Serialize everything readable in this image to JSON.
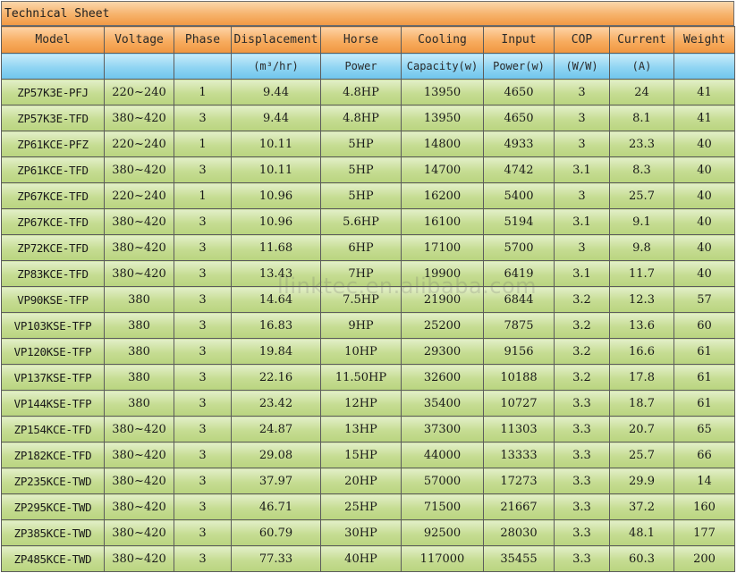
{
  "sheet_title": "Technical Sheet",
  "watermark": "llinktec.en.alibaba.com",
  "header_row1": [
    "Model",
    "Voltage",
    "Phase",
    "Displacement",
    "Horse",
    "Cooling",
    "Input",
    "COP",
    "Current",
    "Weight"
  ],
  "header_row2": [
    "",
    "",
    "",
    "(m³/hr)",
    "Power",
    "Capacity(w)",
    "Power(w)",
    "(W/W)",
    "(A)",
    ""
  ],
  "rows": [
    [
      "ZP57K3E-PFJ",
      "220~240",
      "1",
      "9.44",
      "4.8HP",
      "13950",
      "4650",
      "3",
      "24",
      "41"
    ],
    [
      "ZP57K3E-TFD",
      "380~420",
      "3",
      "9.44",
      "4.8HP",
      "13950",
      "4650",
      "3",
      "8.1",
      "41"
    ],
    [
      "ZP61KCE-PFZ",
      "220~240",
      "1",
      "10.11",
      "5HP",
      "14800",
      "4933",
      "3",
      "23.3",
      "40"
    ],
    [
      "ZP61KCE-TFD",
      "380~420",
      "3",
      "10.11",
      "5HP",
      "14700",
      "4742",
      "3.1",
      "8.3",
      "40"
    ],
    [
      "ZP67KCE-TFD",
      "220~240",
      "1",
      "10.96",
      "5HP",
      "16200",
      "5400",
      "3",
      "25.7",
      "40"
    ],
    [
      "ZP67KCE-TFD",
      "380~420",
      "3",
      "10.96",
      "5.6HP",
      "16100",
      "5194",
      "3.1",
      "9.1",
      "40"
    ],
    [
      "ZP72KCE-TFD",
      "380~420",
      "3",
      "11.68",
      "6HP",
      "17100",
      "5700",
      "3",
      "9.8",
      "40"
    ],
    [
      "ZP83KCE-TFD",
      "380~420",
      "3",
      "13.43",
      "7HP",
      "19900",
      "6419",
      "3.1",
      "11.7",
      "40"
    ],
    [
      "VP90KSE-TFP",
      "380",
      "3",
      "14.64",
      "7.5HP",
      "21900",
      "6844",
      "3.2",
      "12.3",
      "57"
    ],
    [
      "VP103KSE-TFP",
      "380",
      "3",
      "16.83",
      "9HP",
      "25200",
      "7875",
      "3.2",
      "13.6",
      "60"
    ],
    [
      "VP120KSE-TFP",
      "380",
      "3",
      "19.84",
      "10HP",
      "29300",
      "9156",
      "3.2",
      "16.6",
      "61"
    ],
    [
      "VP137KSE-TFP",
      "380",
      "3",
      "22.16",
      "11.50HP",
      "32600",
      "10188",
      "3.2",
      "17.8",
      "61"
    ],
    [
      "VP144KSE-TFP",
      "380",
      "3",
      "23.42",
      "12HP",
      "35400",
      "10727",
      "3.3",
      "18.7",
      "61"
    ],
    [
      "ZP154KCE-TFD",
      "380~420",
      "3",
      "24.87",
      "13HP",
      "37300",
      "11303",
      "3.3",
      "20.7",
      "65"
    ],
    [
      "ZP182KCE-TFD",
      "380~420",
      "3",
      "29.08",
      "15HP",
      "44000",
      "13333",
      "3.3",
      "25.7",
      "66"
    ],
    [
      "ZP235KCE-TWD",
      "380~420",
      "3",
      "37.97",
      "20HP",
      "57000",
      "17273",
      "3.3",
      "29.9",
      "14"
    ],
    [
      "ZP295KCE-TWD",
      "380~420",
      "3",
      "46.71",
      "25HP",
      "71500",
      "21667",
      "3.3",
      "37.2",
      "160"
    ],
    [
      "ZP385KCE-TWD",
      "380~420",
      "3",
      "60.79",
      "30HP",
      "92500",
      "28030",
      "3.3",
      "48.1",
      "177"
    ],
    [
      "ZP485KCE-TWD",
      "380~420",
      "3",
      "77.33",
      "40HP",
      "117000",
      "35455",
      "3.3",
      "60.3",
      "200"
    ]
  ]
}
